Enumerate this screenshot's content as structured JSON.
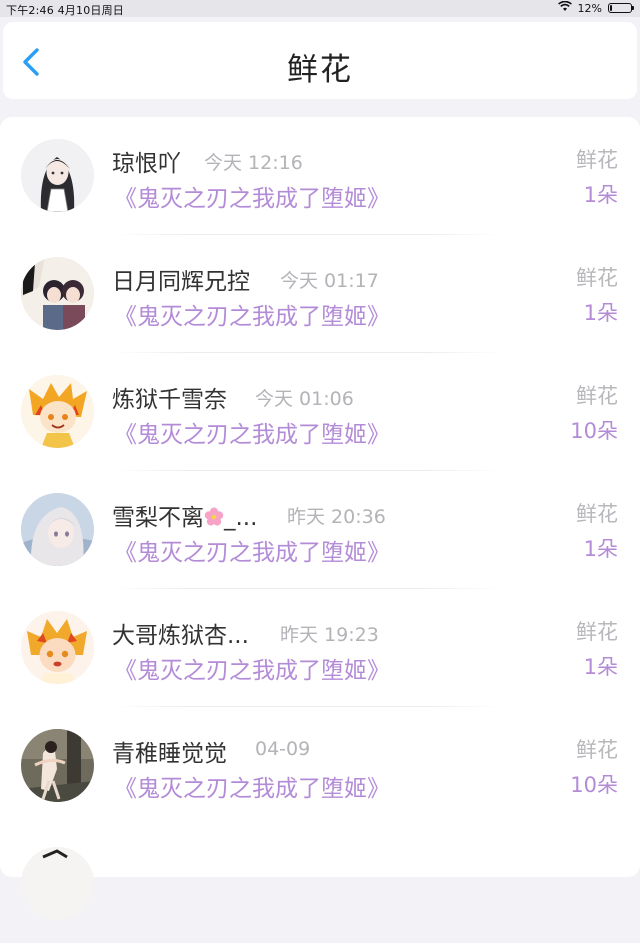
{
  "status_bar": {
    "time_date": "下午2:46   4月10日周日",
    "battery_text": "12%",
    "battery_level": 0.12
  },
  "nav": {
    "title": "鲜花",
    "back_icon": "chevron-left-icon",
    "accent": "#2a9ff5"
  },
  "entries": [
    {
      "user": "琼恨吖",
      "time": "今天 12:16",
      "book": "《鬼灭之刃之我成了堕姬》",
      "gift": "鲜花",
      "count": "1朵"
    },
    {
      "user": "日月同辉兄控",
      "time": "今天 01:17",
      "book": "《鬼灭之刃之我成了堕姬》",
      "gift": "鲜花",
      "count": "1朵"
    },
    {
      "user": "炼狱千雪奈",
      "time": "今天 01:06",
      "book": "《鬼灭之刃之我成了堕姬》",
      "gift": "鲜花",
      "count": "10朵"
    },
    {
      "user": "雪梨不离",
      "user_suffix": "_...",
      "time": "昨天 20:36",
      "book": "《鬼灭之刃之我成了堕姬》",
      "gift": "鲜花",
      "count": "1朵"
    },
    {
      "user": "大哥炼狱杏...",
      "time": "昨天 19:23",
      "book": "《鬼灭之刃之我成了堕姬》",
      "gift": "鲜花",
      "count": "1朵"
    },
    {
      "user": "青稚睡觉觉",
      "time": "04-09",
      "book": "《鬼灭之刃之我成了堕姬》",
      "gift": "鲜花",
      "count": "10朵"
    }
  ],
  "colors": {
    "book_title": "#b38bd7",
    "muted": "#b3b3b8",
    "background": "#f2f2f7"
  }
}
